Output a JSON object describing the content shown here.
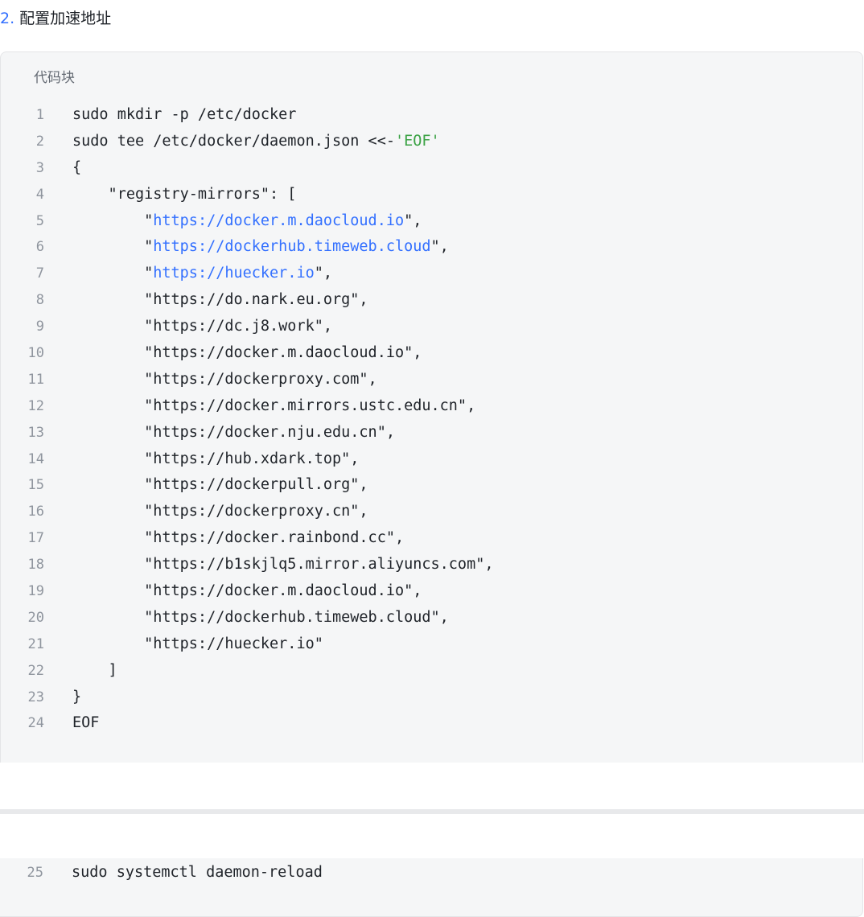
{
  "heading": {
    "number": "2.",
    "title": "配置加速地址"
  },
  "code_block": {
    "label": "代码块",
    "lines": [
      {
        "n": "1",
        "text": "sudo mkdir -p /etc/docker"
      },
      {
        "n": "2",
        "pre": "sudo tee /etc/docker/daemon.json <<-",
        "str": "'EOF'"
      },
      {
        "n": "3",
        "text": "{"
      },
      {
        "n": "4",
        "text": "    \"registry-mirrors\": ["
      },
      {
        "n": "5",
        "pre": "        \"",
        "link": "https://docker.m.daocloud.io",
        "post": "\","
      },
      {
        "n": "6",
        "pre": "        \"",
        "link": "https://dockerhub.timeweb.cloud",
        "post": "\","
      },
      {
        "n": "7",
        "pre": "        \"",
        "link": "https://huecker.io",
        "post": "\","
      },
      {
        "n": "8",
        "text": "        \"https://do.nark.eu.org\","
      },
      {
        "n": "9",
        "text": "        \"https://dc.j8.work\","
      },
      {
        "n": "10",
        "text": "        \"https://docker.m.daocloud.io\","
      },
      {
        "n": "11",
        "text": "        \"https://dockerproxy.com\","
      },
      {
        "n": "12",
        "text": "        \"https://docker.mirrors.ustc.edu.cn\","
      },
      {
        "n": "13",
        "text": "        \"https://docker.nju.edu.cn\","
      },
      {
        "n": "14",
        "text": "        \"https://hub.xdark.top\","
      },
      {
        "n": "15",
        "text": "        \"https://dockerpull.org\","
      },
      {
        "n": "16",
        "text": "        \"https://dockerproxy.cn\","
      },
      {
        "n": "17",
        "text": "        \"https://docker.rainbond.cc\","
      },
      {
        "n": "18",
        "text": "        \"https://b1skjlq5.mirror.aliyuncs.com\","
      },
      {
        "n": "19",
        "text": "        \"https://docker.m.daocloud.io\","
      },
      {
        "n": "20",
        "text": "        \"https://dockerhub.timeweb.cloud\","
      },
      {
        "n": "21",
        "text": "        \"https://huecker.io\""
      },
      {
        "n": "22",
        "text": "    ]"
      },
      {
        "n": "23",
        "text": "}"
      },
      {
        "n": "24",
        "text": "EOF"
      }
    ]
  },
  "code_block_2": {
    "lines": [
      {
        "n": "25",
        "text": "sudo systemctl daemon-reload"
      }
    ]
  },
  "colors": {
    "accent": "#3370ff",
    "string_green": "#3aa244",
    "code_bg": "#f5f6f7",
    "line_number": "#8f959e"
  }
}
